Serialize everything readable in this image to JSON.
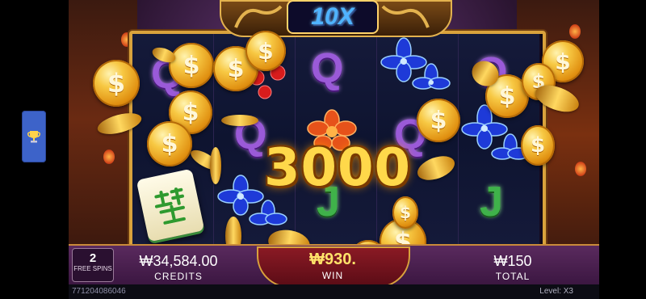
{
  "game": {
    "multiplier": "10X",
    "big_win_amount": "3000"
  },
  "symbols": {
    "reel2_top": "Q",
    "reel3_top": "Q",
    "reel3_mid": "Q",
    "reel4_mid": "Q",
    "reel5_top": "Q",
    "reel3_bottom": "J",
    "reel5_bottom": "J"
  },
  "coin_symbol": "$",
  "status_bar": {
    "free_spins_count": "2",
    "free_spins_label": "FREE SPINS",
    "credits_value": "₩34,584.00",
    "credits_label": "CREDITS",
    "win_value": "₩930.",
    "win_label": "WIN",
    "total_value": "₩150",
    "total_label": "TOTAL"
  },
  "footer": {
    "round_id": "771204086046",
    "level": "Level: X3"
  },
  "colors": {
    "accent_gold": "#ffd84a",
    "multiplier_blue": "#4fb3ff",
    "trophy_button": "#3d63c9",
    "bar_purple": "#4a1f50"
  },
  "icons": [
    "trophy-icon",
    "coin-icon",
    "flower-icon",
    "mahjong-tile-icon"
  ]
}
